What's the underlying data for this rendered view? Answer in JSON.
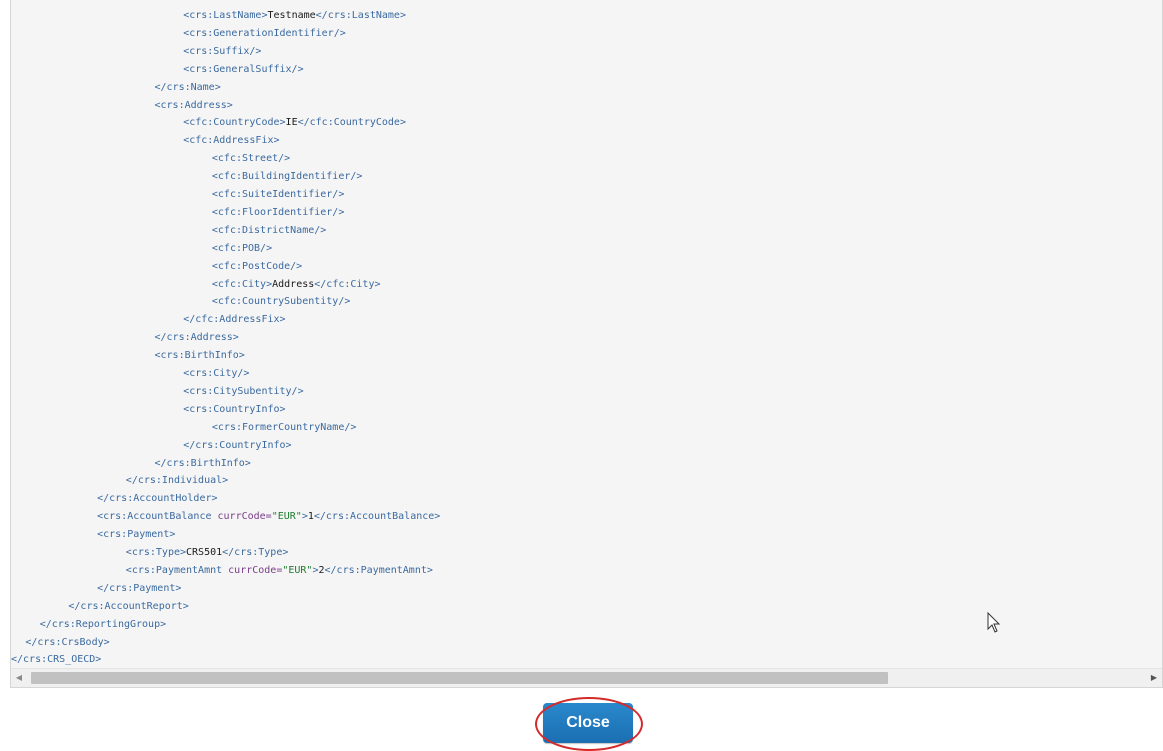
{
  "viewer": {
    "lines": [
      {
        "indent": 6,
        "tokens": [
          {
            "t": "tag",
            "v": "<crs:LastName>"
          },
          {
            "t": "text",
            "v": "Testname"
          },
          {
            "t": "tag",
            "v": "</crs:LastName>"
          }
        ]
      },
      {
        "indent": 6,
        "tokens": [
          {
            "t": "tag",
            "v": "<crs:GenerationIdentifier/>"
          }
        ]
      },
      {
        "indent": 6,
        "tokens": [
          {
            "t": "tag",
            "v": "<crs:Suffix/>"
          }
        ]
      },
      {
        "indent": 6,
        "tokens": [
          {
            "t": "tag",
            "v": "<crs:GeneralSuffix/>"
          }
        ]
      },
      {
        "indent": 5,
        "tokens": [
          {
            "t": "tag",
            "v": "</crs:Name>"
          }
        ]
      },
      {
        "indent": 5,
        "tokens": [
          {
            "t": "tag",
            "v": "<crs:Address>"
          }
        ]
      },
      {
        "indent": 6,
        "tokens": [
          {
            "t": "tag",
            "v": "<cfc:CountryCode>"
          },
          {
            "t": "text",
            "v": "IE"
          },
          {
            "t": "tag",
            "v": "</cfc:CountryCode>"
          }
        ]
      },
      {
        "indent": 6,
        "tokens": [
          {
            "t": "tag",
            "v": "<cfc:AddressFix>"
          }
        ]
      },
      {
        "indent": 7,
        "tokens": [
          {
            "t": "tag",
            "v": "<cfc:Street/>"
          }
        ]
      },
      {
        "indent": 7,
        "tokens": [
          {
            "t": "tag",
            "v": "<cfc:BuildingIdentifier/>"
          }
        ]
      },
      {
        "indent": 7,
        "tokens": [
          {
            "t": "tag",
            "v": "<cfc:SuiteIdentifier/>"
          }
        ]
      },
      {
        "indent": 7,
        "tokens": [
          {
            "t": "tag",
            "v": "<cfc:FloorIdentifier/>"
          }
        ]
      },
      {
        "indent": 7,
        "tokens": [
          {
            "t": "tag",
            "v": "<cfc:DistrictName/>"
          }
        ]
      },
      {
        "indent": 7,
        "tokens": [
          {
            "t": "tag",
            "v": "<cfc:POB/>"
          }
        ]
      },
      {
        "indent": 7,
        "tokens": [
          {
            "t": "tag",
            "v": "<cfc:PostCode/>"
          }
        ]
      },
      {
        "indent": 7,
        "tokens": [
          {
            "t": "tag",
            "v": "<cfc:City>"
          },
          {
            "t": "text",
            "v": "Address"
          },
          {
            "t": "tag",
            "v": "</cfc:City>"
          }
        ]
      },
      {
        "indent": 7,
        "tokens": [
          {
            "t": "tag",
            "v": "<cfc:CountrySubentity/>"
          }
        ]
      },
      {
        "indent": 6,
        "tokens": [
          {
            "t": "tag",
            "v": "</cfc:AddressFix>"
          }
        ]
      },
      {
        "indent": 5,
        "tokens": [
          {
            "t": "tag",
            "v": "</crs:Address>"
          }
        ]
      },
      {
        "indent": 5,
        "tokens": [
          {
            "t": "tag",
            "v": "<crs:BirthInfo>"
          }
        ]
      },
      {
        "indent": 6,
        "tokens": [
          {
            "t": "tag",
            "v": "<crs:City/>"
          }
        ]
      },
      {
        "indent": 6,
        "tokens": [
          {
            "t": "tag",
            "v": "<crs:CitySubentity/>"
          }
        ]
      },
      {
        "indent": 6,
        "tokens": [
          {
            "t": "tag",
            "v": "<crs:CountryInfo>"
          }
        ]
      },
      {
        "indent": 7,
        "tokens": [
          {
            "t": "tag",
            "v": "<crs:FormerCountryName/>"
          }
        ]
      },
      {
        "indent": 6,
        "tokens": [
          {
            "t": "tag",
            "v": "</crs:CountryInfo>"
          }
        ]
      },
      {
        "indent": 5,
        "tokens": [
          {
            "t": "tag",
            "v": "</crs:BirthInfo>"
          }
        ]
      },
      {
        "indent": 4,
        "tokens": [
          {
            "t": "tag",
            "v": "</crs:Individual>"
          }
        ]
      },
      {
        "indent": 3,
        "tokens": [
          {
            "t": "tag",
            "v": "</crs:AccountHolder>"
          }
        ]
      },
      {
        "indent": 3,
        "tokens": [
          {
            "t": "tag",
            "v": "<crs:AccountBalance "
          },
          {
            "t": "attr",
            "v": "currCode="
          },
          {
            "t": "val",
            "v": "\"EUR\""
          },
          {
            "t": "tag",
            "v": ">"
          },
          {
            "t": "text",
            "v": "1"
          },
          {
            "t": "tag",
            "v": "</crs:AccountBalance>"
          }
        ]
      },
      {
        "indent": 3,
        "tokens": [
          {
            "t": "tag",
            "v": "<crs:Payment>"
          }
        ]
      },
      {
        "indent": 4,
        "tokens": [
          {
            "t": "tag",
            "v": "<crs:Type>"
          },
          {
            "t": "text",
            "v": "CRS501"
          },
          {
            "t": "tag",
            "v": "</crs:Type>"
          }
        ]
      },
      {
        "indent": 4,
        "tokens": [
          {
            "t": "tag",
            "v": "<crs:PaymentAmnt "
          },
          {
            "t": "attr",
            "v": "currCode="
          },
          {
            "t": "val",
            "v": "\"EUR\""
          },
          {
            "t": "tag",
            "v": ">"
          },
          {
            "t": "text",
            "v": "2"
          },
          {
            "t": "tag",
            "v": "</crs:PaymentAmnt>"
          }
        ]
      },
      {
        "indent": 3,
        "tokens": [
          {
            "t": "tag",
            "v": "</crs:Payment>"
          }
        ]
      },
      {
        "indent": 2,
        "tokens": [
          {
            "t": "tag",
            "v": "</crs:AccountReport>"
          }
        ]
      },
      {
        "indent": 1,
        "tokens": [
          {
            "t": "tag",
            "v": "</crs:ReportingGroup>"
          }
        ]
      },
      {
        "indent": 0.5,
        "tokens": [
          {
            "t": "tag",
            "v": "</crs:CrsBody>"
          }
        ]
      },
      {
        "indent": 0,
        "tokens": [
          {
            "t": "tag",
            "v": "</crs:CRS_OECD>"
          }
        ]
      }
    ]
  },
  "scrollbar": {
    "left_arrow": "◀",
    "right_arrow": "▶",
    "thumb_fraction": 0.77
  },
  "actions": {
    "close_label": "Close"
  },
  "colors": {
    "button": "#1f77bd",
    "highlight_ring": "#d42a2a"
  }
}
